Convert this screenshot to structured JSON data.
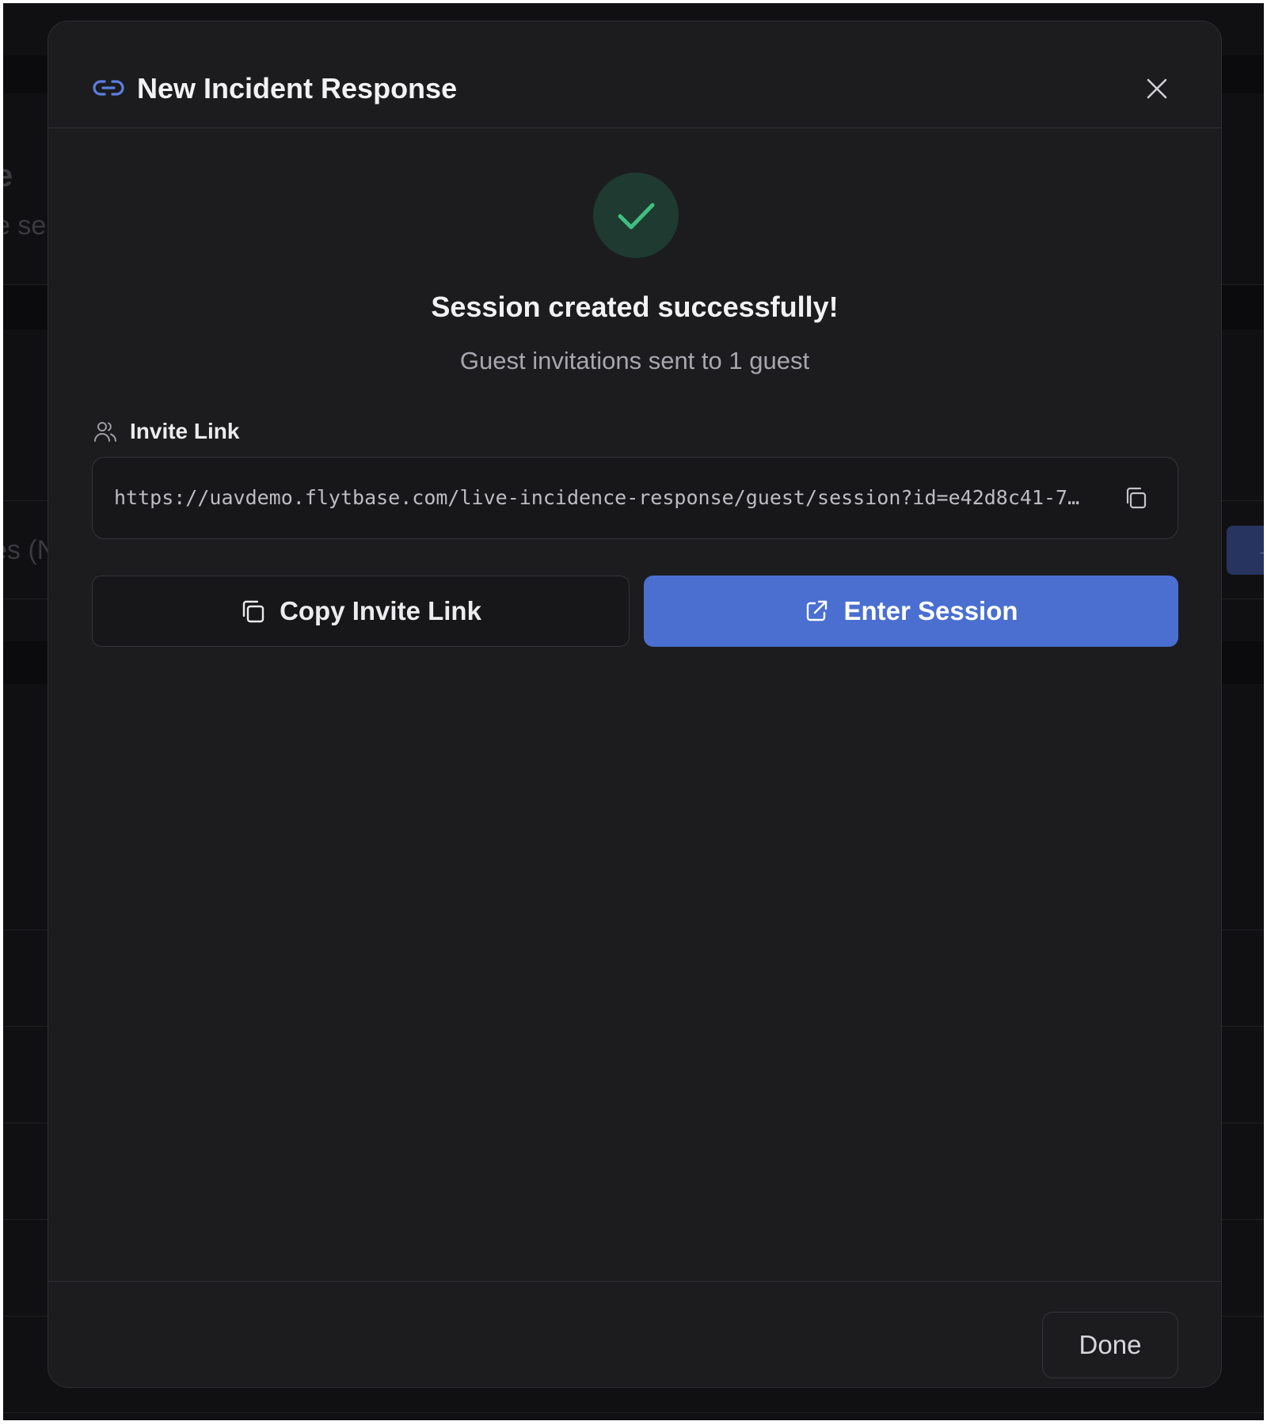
{
  "background": {
    "fragments": [
      "e",
      "e se",
      "es (N"
    ]
  },
  "modal": {
    "title": "New Incident Response",
    "title_icon": "link-icon",
    "close_icon": "close-icon"
  },
  "success": {
    "icon": "check-icon",
    "title": "Session created successfully!",
    "subtitle": "Guest invitations sent to 1 guest"
  },
  "invite": {
    "label": "Invite Link",
    "label_icon": "users-icon",
    "url": "https://uavdemo.flytbase.com/live-incidence-response/guest/session?id=e42d8c41-7fb…",
    "copy_icon": "copy-icon"
  },
  "actions": {
    "copy_label": "Copy Invite Link",
    "enter_label": "Enter Session",
    "enter_icon": "external-link-icon"
  },
  "footer": {
    "done_label": "Done"
  },
  "colors": {
    "accent": "#4a6fd0",
    "success": "#3fbf7f",
    "success_bg": "#1f3a30",
    "surface": "#1c1c1f"
  }
}
